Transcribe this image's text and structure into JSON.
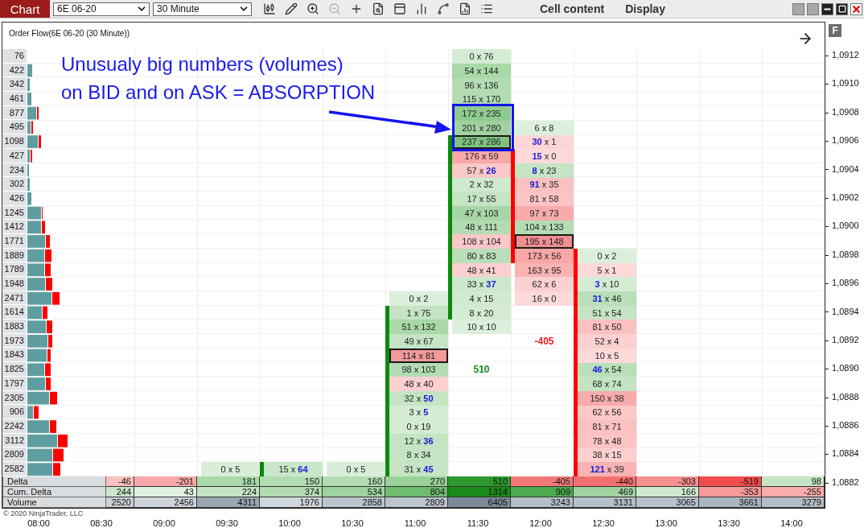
{
  "toolbar": {
    "tab": "Chart",
    "instrument": "6E 06-20",
    "interval": "30 Minute",
    "tools": [
      {
        "kind": "candlestick",
        "disabled": false
      },
      {
        "kind": "pencil",
        "disabled": false
      },
      {
        "kind": "zoom-in",
        "disabled": false
      },
      {
        "kind": "zoom-out",
        "disabled": true
      },
      {
        "kind": "crosshair",
        "disabled": false
      },
      {
        "kind": "file-search",
        "disabled": false
      },
      {
        "kind": "panel",
        "disabled": false
      },
      {
        "kind": "bars",
        "disabled": false
      },
      {
        "kind": "spline",
        "disabled": false
      },
      {
        "kind": "file-chart",
        "disabled": false
      },
      {
        "kind": "list",
        "disabled": false
      }
    ],
    "menus": [
      "Cell content",
      "Display"
    ]
  },
  "chart": {
    "title": "Order Flow(6E 06-20 (30 Minute))",
    "format_button": "F",
    "annotation": {
      "lines": [
        "Unusualy big numbers (volumes)",
        "on BID and on ASK = ABSORPTION"
      ]
    },
    "copyright": "© 2020 NinjaTrader, LLC",
    "profile": [
      "76",
      "422",
      "342",
      "461",
      "877",
      "495",
      "1098",
      "427",
      "234",
      "302",
      "426",
      "1245",
      "1412",
      "1771",
      "1889",
      "1789",
      "1948",
      "2471",
      "1614",
      "1883",
      "1973",
      "1843",
      "1825",
      "1797",
      "2305",
      "906",
      "2242",
      "3112",
      "2809",
      "2582"
    ],
    "table_labels": [
      "Delta",
      "Cum. Delta",
      "Volume"
    ],
    "columns": [
      {
        "time": "08:00"
      },
      {
        "time": "08:30",
        "table": [
          {
            "text": "-46",
            "color": "#f9c0c0"
          },
          {
            "text": "244",
            "color": "#c9e7c9"
          },
          {
            "text": "2520",
            "color": "#c8d0d8"
          }
        ]
      },
      {
        "time": "09:00",
        "table": [
          {
            "text": "-201",
            "color": "#f8a8a8"
          },
          {
            "text": "43",
            "color": "#e2f2e2"
          },
          {
            "text": "2456",
            "color": "#ccd3da"
          }
        ]
      },
      {
        "time": "09:30",
        "table": [
          {
            "text": "181",
            "color": "#a9d9a9"
          },
          {
            "text": "224",
            "color": "#c4e4c4"
          },
          {
            "text": "4311",
            "color": "#9aa6b2"
          }
        ],
        "cells": [
          {
            "kind": "volume",
            "text": "0 x 5",
            "color": "#d9eed9",
            "outlined": false,
            "body": false
          }
        ]
      },
      {
        "time": "10:00",
        "kind": "rising",
        "table": [
          {
            "text": "150",
            "color": "#b3dcb3"
          },
          {
            "text": "374",
            "color": "#b3dcb3"
          },
          {
            "text": "1976",
            "color": "#d0d7de"
          }
        ],
        "cells": [
          {
            "kind": "volume",
            "text": "15 x **64**",
            "color": "#c9e7c9",
            "outlined": false,
            "body": true
          }
        ]
      },
      {
        "time": "10:30",
        "table": [
          {
            "text": "160",
            "color": "#b3dcb3"
          },
          {
            "text": "534",
            "color": "#9fd29f"
          },
          {
            "text": "2858",
            "color": "#bcc5ce"
          }
        ],
        "cells": [
          {
            "kind": "volume",
            "text": "0 x 5",
            "color": "#d9eed9",
            "outlined": false,
            "body": false
          }
        ]
      },
      {
        "time": "11:00",
        "kind": "rising",
        "table": [
          {
            "text": "270",
            "color": "#99d199"
          },
          {
            "text": "804",
            "color": "#6fbb6f"
          },
          {
            "text": "2809",
            "color": "#bcc5ce"
          }
        ],
        "cells": [
          {
            "kind": "volume",
            "text": "0 x 2",
            "color": "#dcefdc",
            "outlined": false,
            "body": false
          },
          {
            "kind": "volume",
            "text": "1 x 75",
            "color": "#c4e4c4",
            "outlined": false,
            "body": true
          },
          {
            "kind": "volume",
            "text": "51 x 132",
            "color": "#a9d9a9",
            "outlined": false,
            "body": true
          },
          {
            "kind": "volume",
            "text": "49 x 67",
            "color": "#c4e4c4",
            "outlined": false,
            "body": true
          },
          {
            "kind": "volume",
            "text": "114 x 81",
            "color": "#f19a9a",
            "outlined": true,
            "body": true
          },
          {
            "kind": "volume",
            "text": "98 x 103",
            "color": "#b3dcb3",
            "outlined": false,
            "body": true
          },
          {
            "kind": "volume",
            "text": "48 x 40",
            "color": "#fcd0d0",
            "outlined": false,
            "body": true
          },
          {
            "kind": "volume",
            "text": "32 x **50**",
            "color": "#c4e4c4",
            "outlined": false,
            "body": true
          },
          {
            "kind": "volume",
            "text": "3 x **5**",
            "color": "#d4ecd4",
            "outlined": false,
            "body": true
          },
          {
            "kind": "volume",
            "text": "0 x 19",
            "color": "#d4ecd4",
            "outlined": false,
            "body": true
          },
          {
            "kind": "volume",
            "text": "12 x **36**",
            "color": "#c4e4c4",
            "outlined": false,
            "body": true
          },
          {
            "kind": "volume",
            "text": "8 x 34",
            "color": "#c4e4c4",
            "outlined": false,
            "body": true
          },
          {
            "kind": "volume",
            "text": "31 x **45**",
            "color": "#c4e4c4",
            "outlined": false,
            "body": true
          }
        ]
      },
      {
        "time": "11:30",
        "kind": "rising",
        "table": [
          {
            "text": "510",
            "color": "#2e9a2e"
          },
          {
            "text": "1314",
            "color": "#1a8a1a"
          },
          {
            "text": "6405",
            "color": "#7c8a99"
          }
        ],
        "cells": [
          {
            "kind": "volume",
            "text": "0 x 76",
            "color": "#d4ecd4",
            "outlined": false,
            "body": false
          },
          {
            "kind": "volume",
            "text": "54 x 144",
            "color": "#a9d9a9",
            "outlined": false,
            "body": false
          },
          {
            "kind": "volume",
            "text": "96 x 136",
            "color": "#b3dcb3",
            "outlined": false,
            "body": false
          },
          {
            "kind": "volume",
            "text": "115 x 170",
            "color": "#b3dcb3",
            "outlined": false,
            "body": false
          },
          {
            "kind": "volume",
            "text": "172 x 235",
            "color": "#8fcb8f",
            "outlined": false,
            "body": false
          },
          {
            "kind": "volume",
            "text": "201 x 280",
            "color": "#9fd29f",
            "outlined": false,
            "body": false
          },
          {
            "kind": "volume",
            "text": "237 x 286",
            "color": "#7fc27f",
            "outlined": true,
            "body": true
          },
          {
            "kind": "volume",
            "text": "176 x 59",
            "color": "#f7a8a8",
            "outlined": false,
            "body": true
          },
          {
            "kind": "volume",
            "text": "57 x **26**",
            "color": "#fbc8c8",
            "outlined": false,
            "body": true
          },
          {
            "kind": "volume",
            "text": "2 x 32",
            "color": "#d0ead0",
            "outlined": false,
            "body": true
          },
          {
            "kind": "volume",
            "text": "17 x 55",
            "color": "#c4e4c4",
            "outlined": false,
            "body": true
          },
          {
            "kind": "volume",
            "text": "47 x 103",
            "color": "#a6d6a6",
            "outlined": false,
            "body": true
          },
          {
            "kind": "volume",
            "text": "48 x 111",
            "color": "#b3dcb3",
            "outlined": false,
            "body": true
          },
          {
            "kind": "volume",
            "text": "108 x 104",
            "color": "#fbc8c8",
            "outlined": false,
            "body": true
          },
          {
            "kind": "volume",
            "text": "80 x 83",
            "color": "#b9dfb9",
            "outlined": false,
            "body": true
          },
          {
            "kind": "volume",
            "text": "48 x 41",
            "color": "#fcd0d0",
            "outlined": false,
            "body": true
          },
          {
            "kind": "volume",
            "text": "33 x **37**",
            "color": "#cce8cc",
            "outlined": false,
            "body": true
          },
          {
            "kind": "volume",
            "text": "4 x 15",
            "color": "#d0ead0",
            "outlined": false,
            "body": true
          },
          {
            "kind": "volume",
            "text": "8 x 20",
            "color": "#d4ecd4",
            "outlined": false,
            "body": true
          },
          {
            "kind": "volume",
            "text": "10 x 10",
            "color": "#dcefdc",
            "outlined": false,
            "body": false
          },
          {
            "kind": "empty"
          },
          {
            "kind": "empty"
          },
          {
            "kind": "delta",
            "text": "510",
            "color": "#1a8a1a"
          },
          {
            "kind": "empty"
          },
          {
            "kind": "empty"
          },
          {
            "kind": "empty"
          },
          {
            "kind": "empty"
          },
          {
            "kind": "empty"
          },
          {
            "kind": "empty"
          },
          {
            "kind": "empty"
          }
        ]
      },
      {
        "time": "12:00",
        "kind": "falling",
        "table": [
          {
            "text": "-405",
            "color": "#f27878"
          },
          {
            "text": "909",
            "color": "#4da94d"
          },
          {
            "text": "3243",
            "color": "#b4bec8"
          }
        ],
        "cells": [
          {
            "kind": "volume",
            "text": "6 x 8",
            "color": "#dcefdc",
            "outlined": false,
            "body": false
          },
          {
            "kind": "volume",
            "text": "**30** x 1",
            "color": "#fcd6d6",
            "outlined": false,
            "body": false
          },
          {
            "kind": "volume",
            "text": "**15** x 0",
            "color": "#fdd9d9",
            "outlined": false,
            "body": true
          },
          {
            "kind": "volume",
            "text": "**8** x 23",
            "color": "#c4e4c4",
            "outlined": false,
            "body": true
          },
          {
            "kind": "volume",
            "text": "**91** x 35",
            "color": "#fbc0c0",
            "outlined": false,
            "body": true
          },
          {
            "kind": "volume",
            "text": "81 x 58",
            "color": "#fbc4c4",
            "outlined": false,
            "body": true
          },
          {
            "kind": "volume",
            "text": "97 x 73",
            "color": "#f8abab",
            "outlined": false,
            "body": true
          },
          {
            "kind": "volume",
            "text": "104 x 133",
            "color": "#b3dcb3",
            "outlined": false,
            "body": true
          },
          {
            "kind": "volume",
            "text": "195 x 148",
            "color": "#ef8f8f",
            "outlined": true,
            "body": true
          },
          {
            "kind": "volume",
            "text": "173 x 56",
            "color": "#f8a6a6",
            "outlined": false,
            "body": true
          },
          {
            "kind": "volume",
            "text": "163 x 95",
            "color": "#f9b3b3",
            "outlined": false,
            "body": false
          },
          {
            "kind": "volume",
            "text": "62 x 6",
            "color": "#fcd0d0",
            "outlined": false,
            "body": false
          },
          {
            "kind": "volume",
            "text": "16 x 0",
            "color": "#fdd9d9",
            "outlined": false,
            "body": false
          },
          {
            "kind": "empty"
          },
          {
            "kind": "empty"
          },
          {
            "kind": "delta",
            "text": "-405",
            "color": "#ee1c1c"
          },
          {
            "kind": "empty"
          },
          {
            "kind": "empty"
          },
          {
            "kind": "empty"
          },
          {
            "kind": "empty"
          },
          {
            "kind": "empty"
          },
          {
            "kind": "empty"
          },
          {
            "kind": "empty"
          },
          {
            "kind": "empty"
          },
          {
            "kind": "empty"
          }
        ]
      },
      {
        "time": "12:30",
        "kind": "falling",
        "table": [
          {
            "text": "-440",
            "color": "#f47070"
          },
          {
            "text": "469",
            "color": "#9fd29f"
          },
          {
            "text": "3131",
            "color": "#b6c0ca"
          }
        ],
        "cells": [
          {
            "kind": "volume",
            "text": "0 x 2",
            "color": "#dcefdc",
            "outlined": false,
            "body": true
          },
          {
            "kind": "volume",
            "text": "5 x 1",
            "color": "#fdd9d9",
            "outlined": false,
            "body": true
          },
          {
            "kind": "volume",
            "text": "**3** x 10",
            "color": "#d4ecd4",
            "outlined": false,
            "body": true
          },
          {
            "kind": "volume",
            "text": "**31** x 46",
            "color": "#b9dfb9",
            "outlined": false,
            "body": true
          },
          {
            "kind": "volume",
            "text": "51 x 54",
            "color": "#c4e4c4",
            "outlined": false,
            "body": true
          },
          {
            "kind": "volume",
            "text": "81 x 50",
            "color": "#fbc0c0",
            "outlined": false,
            "body": true
          },
          {
            "kind": "volume",
            "text": "52 x 4",
            "color": "#fcd0d0",
            "outlined": false,
            "body": true
          },
          {
            "kind": "volume",
            "text": "10 x 5",
            "color": "#fdd9d9",
            "outlined": false,
            "body": true
          },
          {
            "kind": "volume",
            "text": "**46** x 54",
            "color": "#b9dfb9",
            "outlined": false,
            "body": true
          },
          {
            "kind": "volume",
            "text": "68 x 74",
            "color": "#c4e4c4",
            "outlined": false,
            "body": true
          },
          {
            "kind": "volume",
            "text": "150 x 38",
            "color": "#f8abab",
            "outlined": false,
            "body": true
          },
          {
            "kind": "volume",
            "text": "62 x 56",
            "color": "#fbc8c8",
            "outlined": false,
            "body": true
          },
          {
            "kind": "volume",
            "text": "81 x 71",
            "color": "#fbc0c0",
            "outlined": false,
            "body": true
          },
          {
            "kind": "volume",
            "text": "78 x 48",
            "color": "#fbc4c4",
            "outlined": false,
            "body": true
          },
          {
            "kind": "volume",
            "text": "38 x 15",
            "color": "#fcd0d0",
            "outlined": false,
            "body": true
          },
          {
            "kind": "volume",
            "text": "**121** x 39",
            "color": "#f9b3b3",
            "outlined": false,
            "body": true
          }
        ]
      },
      {
        "time": "13:00",
        "table": [
          {
            "text": "-303",
            "color": "#f79090"
          },
          {
            "text": "166",
            "color": "#cfe9cf"
          },
          {
            "text": "3065",
            "color": "#b8c2cc"
          }
        ]
      },
      {
        "time": "13:30",
        "table": [
          {
            "text": "-519",
            "color": "#f04c4c"
          },
          {
            "text": "-353",
            "color": "#f69a9a"
          },
          {
            "text": "3661",
            "color": "#aab4be"
          }
        ]
      },
      {
        "time": "14:00",
        "table": [
          {
            "text": "98",
            "color": "#c4e4c4"
          },
          {
            "text": "-255",
            "color": "#f8acac"
          },
          {
            "text": "3279",
            "color": "#b4bec8"
          }
        ]
      }
    ],
    "price_axis": [
      "1,0912",
      "1,0910",
      "1,0908",
      "1,0906",
      "1,0904",
      "1,0902",
      "1,0900",
      "1,0898",
      "1,0896",
      "1,0894",
      "1,0892",
      "1,0890",
      "1,0888",
      "1,0886",
      "1,0884",
      "1,0882"
    ]
  }
}
